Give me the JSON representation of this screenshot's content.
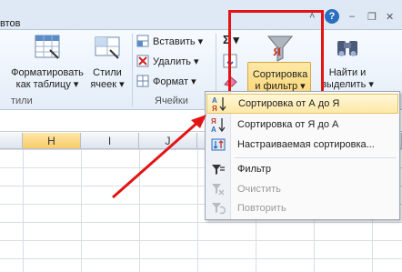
{
  "titlebar": {
    "tab_fragment": "втов",
    "help_label": "?"
  },
  "ribbon": {
    "format_table": {
      "line1": "Форматировать",
      "line2": "как таблицу ▾"
    },
    "cell_styles": {
      "line1": "Стили",
      "line2": "ячеек ▾"
    },
    "insert_label": "Вставить ▾",
    "delete_label": "Удалить ▾",
    "format_label": "Формат ▾",
    "sigma": "Σ ▾",
    "sort_filter": {
      "line1": "Сортировка",
      "line2": "и фильтр ▾"
    },
    "find_select": {
      "line1": "Найти и",
      "line2": "выделить ▾"
    },
    "group_styles": "тили",
    "group_cells": "Ячейки"
  },
  "columns": [
    "H",
    "I",
    "J"
  ],
  "menu": {
    "items": [
      {
        "label": "Сортировка от А до Я",
        "icon": "sort-az-icon",
        "highlighted": true,
        "disabled": false
      },
      {
        "label": "Сортировка от Я до А",
        "icon": "sort-za-icon",
        "highlighted": false,
        "disabled": false
      },
      {
        "label": "Настраиваемая сортировка...",
        "icon": "custom-sort-icon",
        "highlighted": false,
        "disabled": false
      },
      {
        "label": "Фильтр",
        "icon": "filter-icon",
        "highlighted": false,
        "disabled": false
      },
      {
        "label": "Очистить",
        "icon": "clear-filter-icon",
        "highlighted": false,
        "disabled": true
      },
      {
        "label": "Повторить",
        "icon": "reapply-icon",
        "highlighted": false,
        "disabled": true
      }
    ]
  },
  "colors": {
    "highlight_box": "#e21414",
    "arrow": "#e21414",
    "sort_button_fill": "#f8c64d"
  }
}
